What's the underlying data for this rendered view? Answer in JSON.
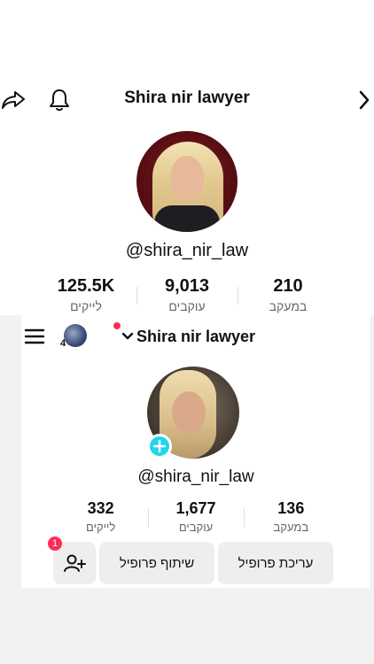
{
  "top": {
    "title": "Shira nir lawyer",
    "handle": "@shira_nir_law",
    "stats": [
      {
        "value": "125.5K",
        "label": "לייקים"
      },
      {
        "value": "9,013",
        "label": "עוקבים"
      },
      {
        "value": "210",
        "label": "במעקב"
      }
    ],
    "icons": {
      "left": "share-icon",
      "bell": "bell-icon",
      "right": "chevron-right-icon"
    }
  },
  "bottom": {
    "title": "Shira nir lawyer",
    "account_count": "4",
    "handle": "@shira_nir_law",
    "stats": [
      {
        "value": "332",
        "label": "לייקים"
      },
      {
        "value": "1,677",
        "label": "עוקבים"
      },
      {
        "value": "136",
        "label": "במעקב"
      }
    ],
    "buttons": {
      "edit_profile": "עריכת פרופיל",
      "share_profile": "שיתוף פרופיל",
      "add_friends_badge": "1"
    }
  },
  "colors": {
    "accent_red": "#fe2c55",
    "accent_cyan": "#20d5ec"
  }
}
